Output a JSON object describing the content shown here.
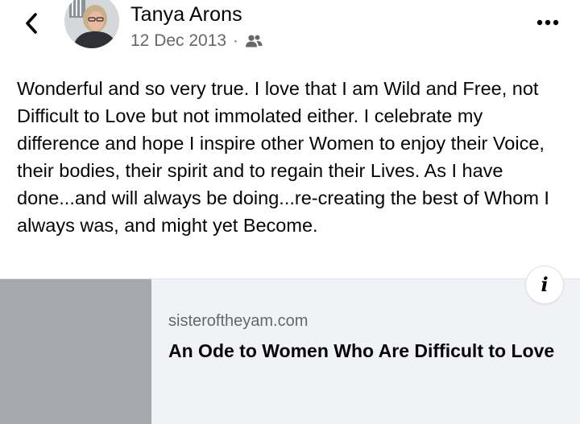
{
  "header": {
    "author_name": "Tanya Arons",
    "date": "12 Dec 2013",
    "separator": "·",
    "audience_icon": "friends-icon",
    "back_icon": "chevron-left-icon",
    "more_icon": "more-horizontal-icon"
  },
  "post": {
    "text": "Wonderful and so very true. I love that I am Wild and Free, not Difficult to Love but not immolated either. I celebrate my difference and hope I inspire other Women to enjoy their Voice, their bodies, their spirit and to regain their Lives.  As I have done...and will always be doing...re-creating the best of Whom I always was, and might yet Become."
  },
  "link_preview": {
    "domain": "sisteroftheyam.com",
    "title": "An Ode to Women Who Are Difficult to Love",
    "info_label": "i"
  },
  "colors": {
    "text": "#050505",
    "secondary_text": "#65676b",
    "card_background": "#f0f2f5",
    "thumbnail": "#a5a8ac"
  }
}
